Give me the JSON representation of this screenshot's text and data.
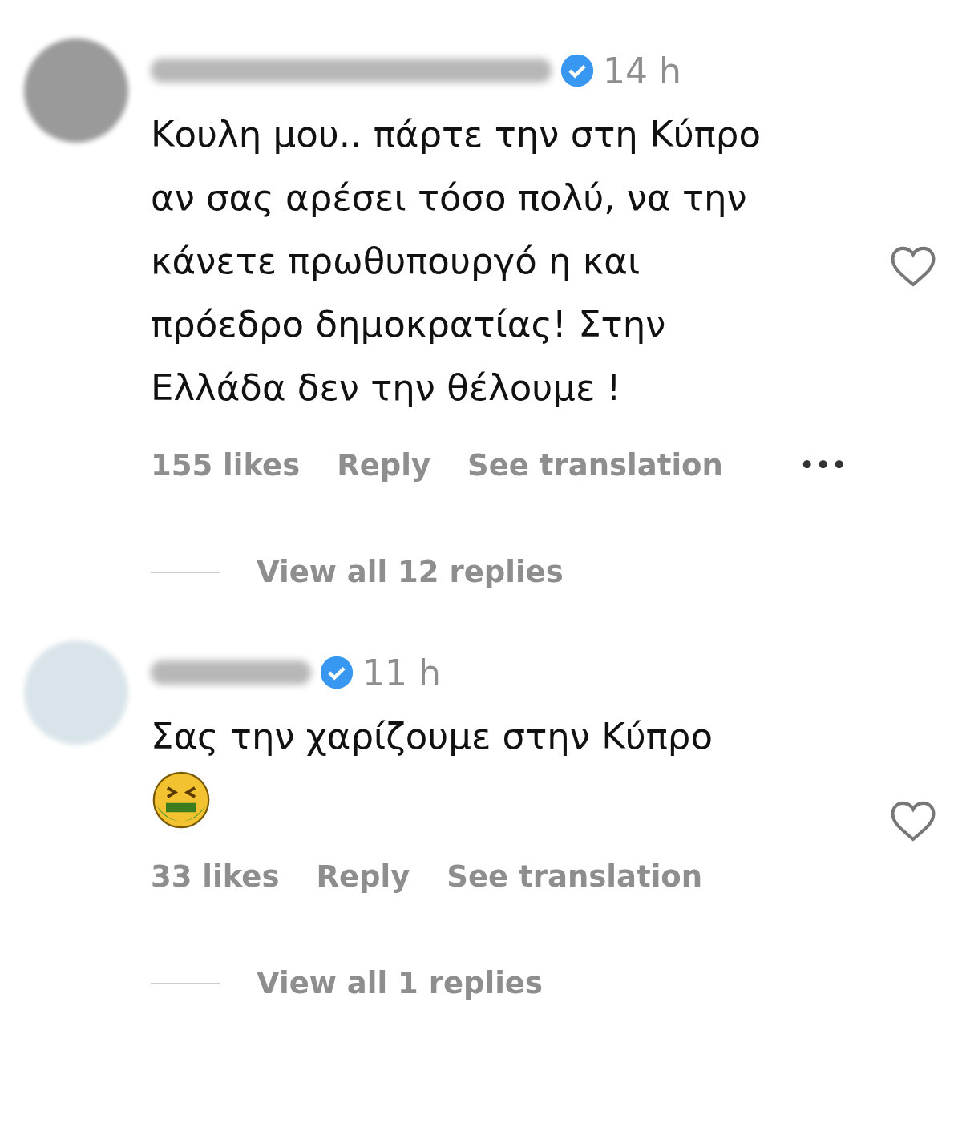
{
  "comments": [
    {
      "time": "14 h",
      "verified": true,
      "text": "Κουλη μου.. πάρτε την στη Κύπρο αν σας αρέσει τόσο πολύ, να την κάνετε πρωθυπουργό η και πρόεδρο δημοκρατίας! Στην Ελλάδα δεν την θέλουμε !",
      "liked": false,
      "likes": "155 likes",
      "reply": "Reply",
      "translation": "See translation",
      "more": "•••",
      "view_replies": "View all 12 replies"
    },
    {
      "time": "11 h",
      "verified": true,
      "text": "Σας την χαρίζουμε στην Κύπρο",
      "emoji": true,
      "liked": false,
      "likes": "33 likes",
      "reply": "Reply",
      "translation": "See translation",
      "view_replies": "View all 1 replies"
    }
  ]
}
